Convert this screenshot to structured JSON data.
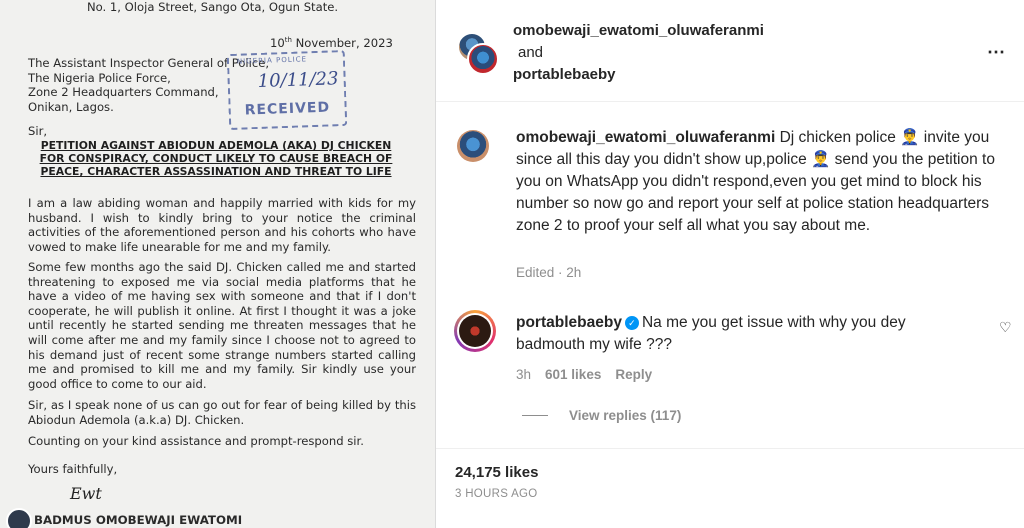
{
  "letter": {
    "address": "No. 1, Oloja Street, Sango Ota, Ogun State.",
    "date_day": "10",
    "date_suffix": "th",
    "date_rest": " November, 2023",
    "recipient": [
      "The Assistant Inspector General of Police,",
      "The Nigeria Police Force,",
      "Zone 2 Headquarters Command,",
      "Onikan, Lagos."
    ],
    "stamp_top": "NIGERIA POLICE",
    "stamp_handwriting": "10/11/23",
    "stamp_label": "RECEIVED",
    "salutation": "Sir,",
    "title": "PETITION AGAINST ABIODUN ADEMOLA (AKA) DJ CHICKEN FOR CONSPIRACY, CONDUCT LIKELY TO CAUSE BREACH OF PEACE, CHARACTER ASSASSINATION AND THREAT TO LIFE",
    "paragraph1": "I am a law abiding woman and happily married with kids for my husband. I wish to kindly bring to your notice the criminal activities of the aforementioned person and his cohorts who have vowed to make life unearable for me and my family.",
    "paragraph2": "Some few months ago the said DJ. Chicken called me and started threatening to exposed me via social media platforms that he have a video of me having sex with someone and that if I don't cooperate, he will publish it online. At first I thought it was a joke until recently he started sending me threaten messages that he will come after me and my family since I choose not to agreed to his demand just of recent some strange numbers started calling me and promised to kill me and my family. Sir kindly use your good office to come to our aid.",
    "paragraph3": "Sir, as I speak none of us can go out for fear of being killed by this Abiodun Ademola (a.k.a) DJ. Chicken.",
    "paragraph4": "Counting on your kind assistance and prompt-respond sir.",
    "closing": "Yours faithfully,",
    "signature": "Ewt",
    "signer": "BADMUS OMOBEWAJI EWATOMI"
  },
  "post": {
    "author1": "omobewaji_ewatomi_oluwaferanmi",
    "and_text": "and",
    "author2": "portablebaeby",
    "more_icon": "⋯"
  },
  "comments": [
    {
      "username": "omobewaji_ewatomi_oluwaferanmi",
      "text": " Dj chicken police 👮‍♂️ invite you since all this day you didn't show up,police 👮‍♂️ send you the petition to you on WhatsApp you didn't respond,even you get mind to block his number so now go and report your self at police station headquarters zone 2 to proof your self all what you say about me.",
      "meta": "Edited · 2h"
    },
    {
      "username": "portablebaeby",
      "verified_icon": "✓",
      "text": "Na me you get issue with why you dey badmouth my wife ???",
      "time": "3h",
      "likes": "601 likes",
      "reply": "Reply",
      "heart_icon": "♡",
      "view_replies": "View replies (117)"
    }
  ],
  "footer": {
    "likes": "24,175 likes",
    "time": "3 HOURS AGO"
  }
}
